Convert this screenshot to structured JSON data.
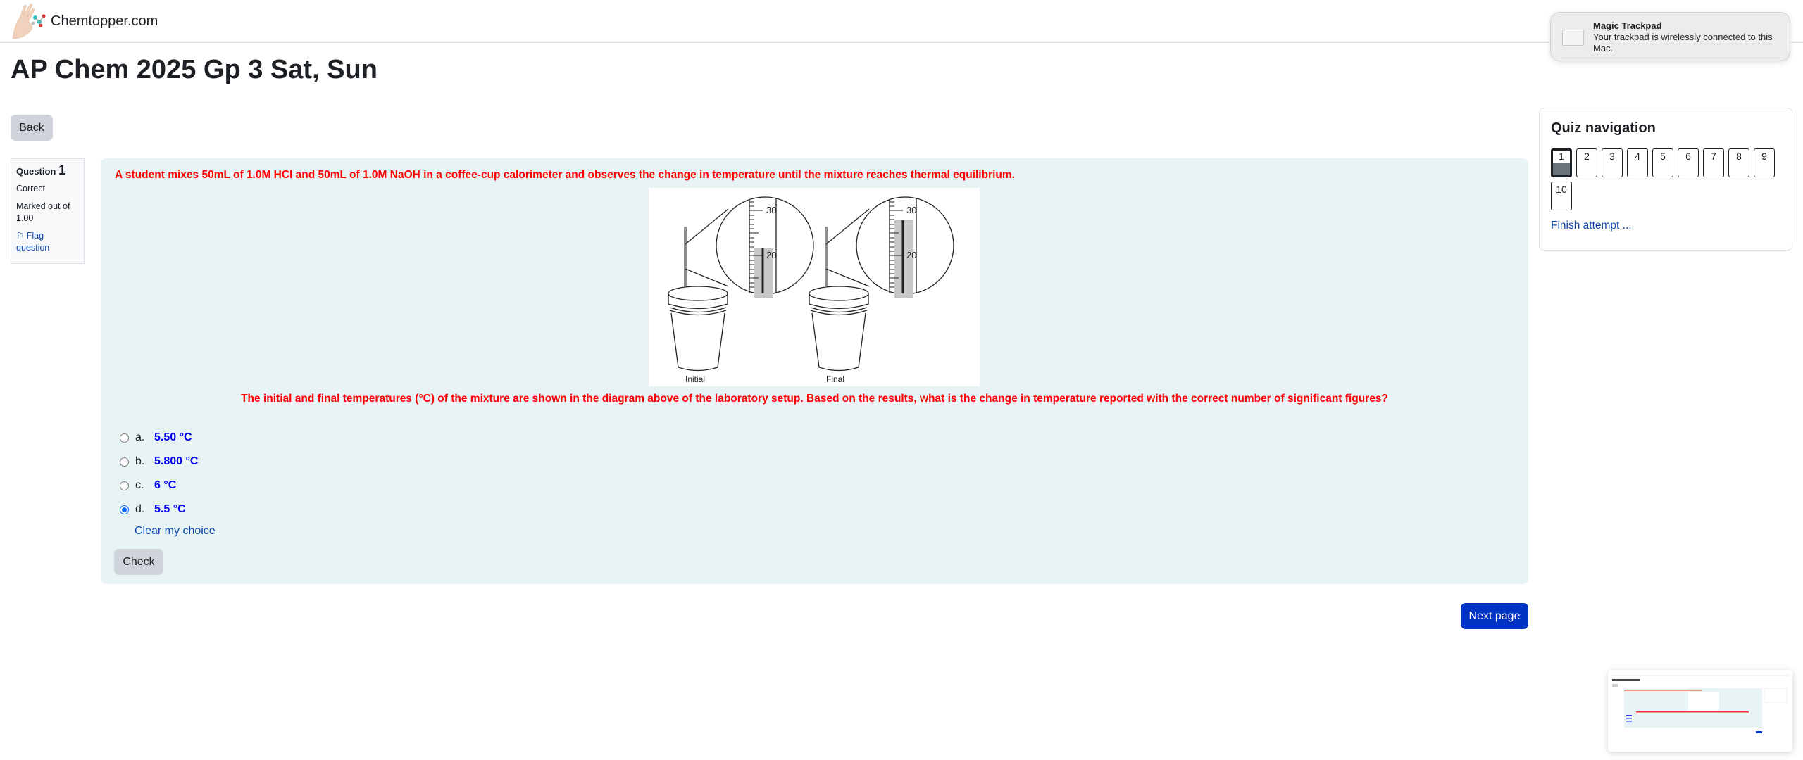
{
  "header": {
    "site_name": "Chemtopper.com",
    "logo_icon": "hand-molecule-logo"
  },
  "page": {
    "title": "AP Chem 2025 Gp 3 Sat, Sun",
    "back_label": "Back"
  },
  "question_info": {
    "label": "Question",
    "number": "1",
    "status": "Correct",
    "marked_out_of": "Marked out of 1.00",
    "flag_label": "Flag question",
    "flag_icon": "flag-icon"
  },
  "question": {
    "text_intro": "A student mixes 50mL of 1.0M HCl and 50mL of 1.0M NaOH in a coffee-cup calorimeter and observes the change in temperature until the mixture reaches thermal equilibrium.",
    "text_prompt": "The initial and final temperatures (°C) of the mixture are shown in the diagram above of the laboratory setup. Based on the results, what is the change in temperature reported with the correct number of significant figures?",
    "text_color": "#ff0000",
    "diagram": {
      "labels": [
        "Initial",
        "Final"
      ],
      "scale_labels": [
        "30",
        "20"
      ]
    },
    "answers": [
      {
        "letter": "a.",
        "value": "5.50 °C",
        "selected": false
      },
      {
        "letter": "b.",
        "value": "5.800 °C",
        "selected": false
      },
      {
        "letter": "c.",
        "value": "6 °C",
        "selected": false
      },
      {
        "letter": "d.",
        "value": "5.5 °C",
        "selected": true
      }
    ],
    "clear_label": "Clear my choice",
    "check_label": "Check"
  },
  "navigation": {
    "next_label": "Next page"
  },
  "quiz_nav": {
    "title": "Quiz navigation",
    "buttons": [
      "1",
      "2",
      "3",
      "4",
      "5",
      "6",
      "7",
      "8",
      "9",
      "10"
    ],
    "current": "1",
    "finish_label": "Finish attempt ..."
  },
  "notification": {
    "title": "Magic Trackpad",
    "body": "Your trackpad is wirelessly connected to this Mac.",
    "icon": "trackpad-icon"
  },
  "colors": {
    "accent": "#0034c3",
    "link": "#0f47ad",
    "answer_text": "#0000ee",
    "question_bg": "#e7f3f5"
  }
}
